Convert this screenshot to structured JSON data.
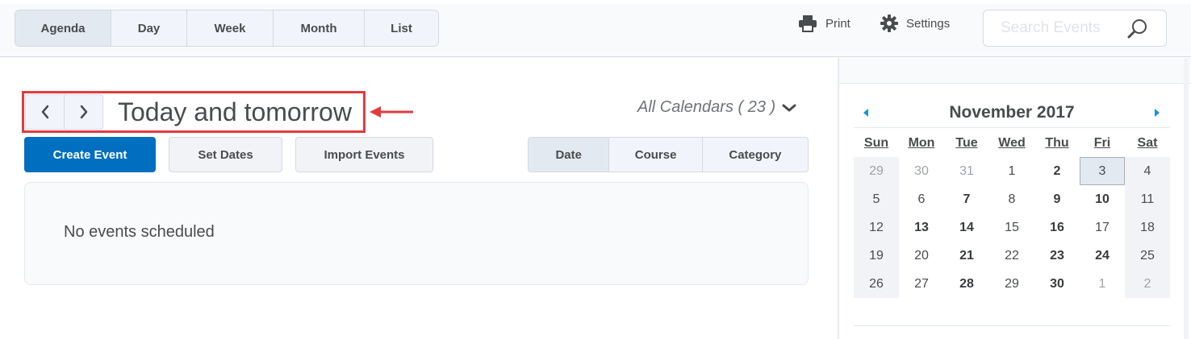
{
  "view_tabs": [
    {
      "label": "Agenda",
      "active": true
    },
    {
      "label": "Day",
      "active": false
    },
    {
      "label": "Week",
      "active": false
    },
    {
      "label": "Month",
      "active": false
    },
    {
      "label": "List",
      "active": false
    }
  ],
  "toolbar": {
    "print_label": "Print",
    "settings_label": "Settings"
  },
  "search": {
    "placeholder": "Search Events"
  },
  "agenda": {
    "title": "Today and tomorrow",
    "calendars_label": "All Calendars ( 23 )",
    "buttons": {
      "create": "Create Event",
      "set_dates": "Set Dates",
      "import": "Import Events"
    },
    "group_by": [
      {
        "label": "Date",
        "active": true
      },
      {
        "label": "Course",
        "active": false
      },
      {
        "label": "Category",
        "active": false
      }
    ],
    "empty_message": "No events scheduled"
  },
  "mini_calendar": {
    "month_label": "November 2017",
    "days_of_week": [
      "Sun",
      "Mon",
      "Tue",
      "Wed",
      "Thu",
      "Fri",
      "Sat"
    ],
    "weeks": [
      [
        {
          "d": "29",
          "m": true
        },
        {
          "d": "30",
          "m": true
        },
        {
          "d": "31",
          "m": true
        },
        {
          "d": "1"
        },
        {
          "d": "2",
          "b": true
        },
        {
          "d": "3",
          "t": true
        },
        {
          "d": "4"
        }
      ],
      [
        {
          "d": "5"
        },
        {
          "d": "6"
        },
        {
          "d": "7",
          "b": true
        },
        {
          "d": "8"
        },
        {
          "d": "9",
          "b": true
        },
        {
          "d": "10",
          "b": true
        },
        {
          "d": "11"
        }
      ],
      [
        {
          "d": "12"
        },
        {
          "d": "13",
          "b": true
        },
        {
          "d": "14",
          "b": true
        },
        {
          "d": "15"
        },
        {
          "d": "16",
          "b": true
        },
        {
          "d": "17"
        },
        {
          "d": "18"
        }
      ],
      [
        {
          "d": "19"
        },
        {
          "d": "20"
        },
        {
          "d": "21",
          "b": true
        },
        {
          "d": "22"
        },
        {
          "d": "23",
          "b": true
        },
        {
          "d": "24",
          "b": true
        },
        {
          "d": "25"
        }
      ],
      [
        {
          "d": "26"
        },
        {
          "d": "27"
        },
        {
          "d": "28",
          "b": true
        },
        {
          "d": "29"
        },
        {
          "d": "30",
          "b": true
        },
        {
          "d": "1",
          "m": true
        },
        {
          "d": "2",
          "m": true
        }
      ]
    ]
  },
  "colors": {
    "primary": "#006fbf",
    "highlight": "#e23a3f",
    "nav_arrow": "#1a8fd9"
  },
  "icons": {
    "print": "printer-icon",
    "settings": "gear-icon",
    "search": "magnifier-icon"
  }
}
